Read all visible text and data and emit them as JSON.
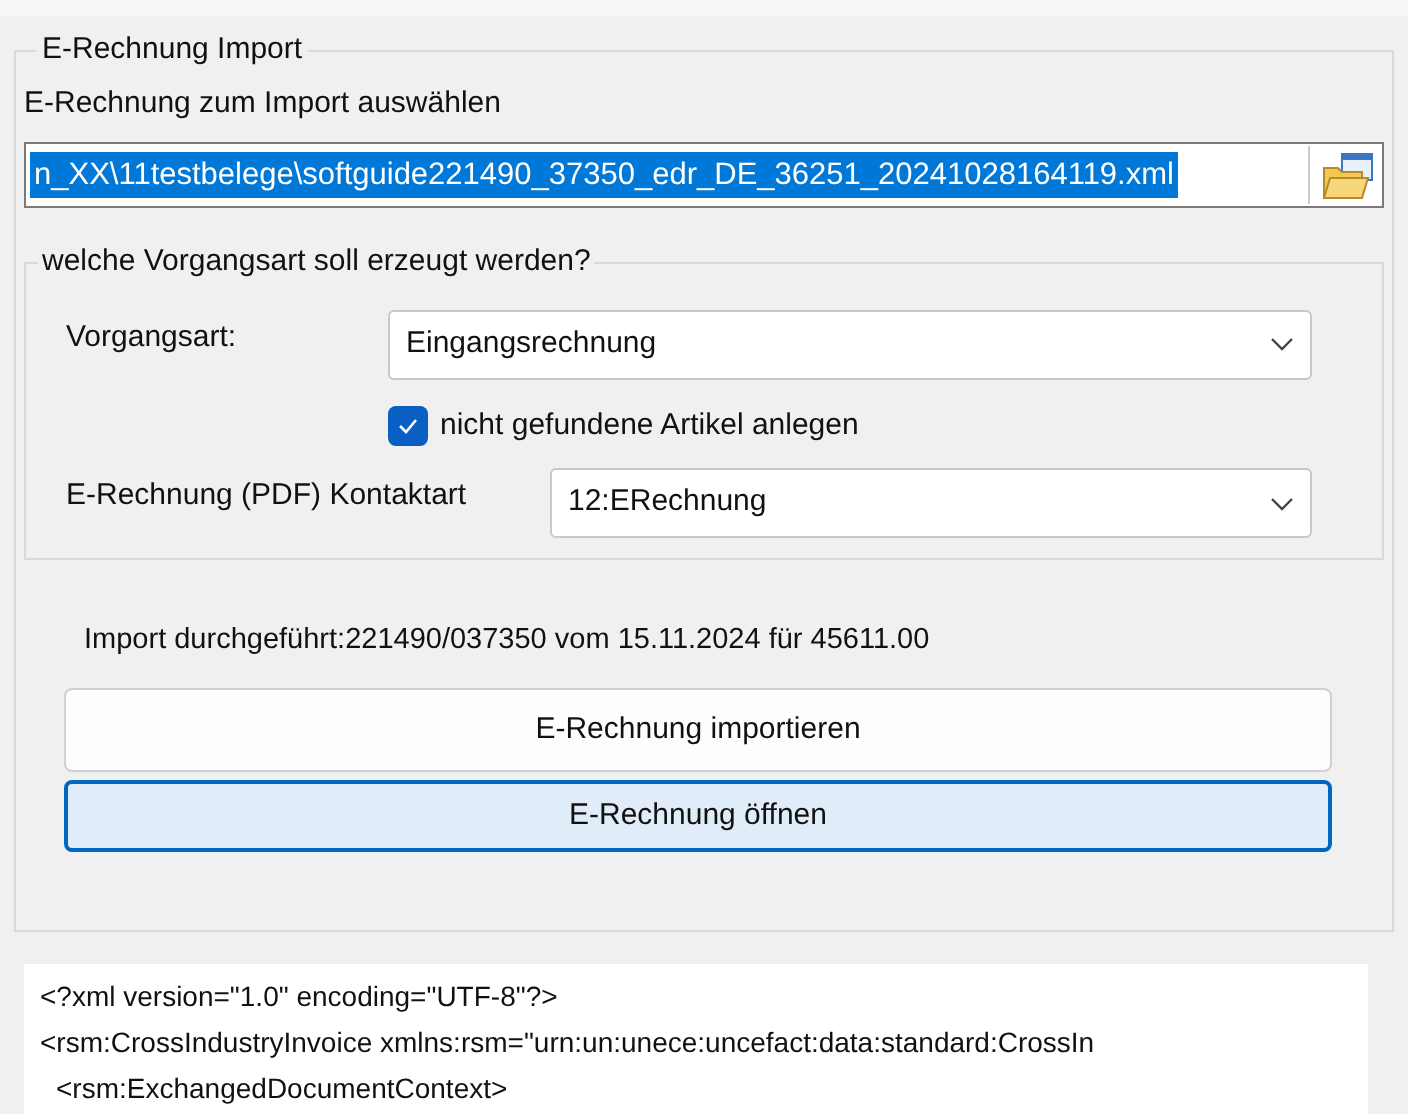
{
  "group": {
    "title": "E-Rechnung Import"
  },
  "file_label": "E-Rechnung zum Import auswählen",
  "file_path": {
    "value": "n_XX\\11testbelege\\softguide221490_37350_edr_DE_36251_20241028164119.xml",
    "selected": true
  },
  "subgroup": {
    "title": "welche Vorgangsart soll erzeugt werden?"
  },
  "vorgangsart": {
    "label": "Vorgangsart:",
    "value": "Eingangsrechnung"
  },
  "checkbox": {
    "label": "nicht gefundene Artikel anlegen",
    "checked": true
  },
  "kontaktart": {
    "label": "E-Rechnung (PDF) Kontaktart",
    "value": "12:ERechnung"
  },
  "status": "Import durchgeführt:221490/037350 vom 15.11.2024 für 45611.00",
  "buttons": [
    {
      "label": "E-Rechnung importieren",
      "focused": false
    },
    {
      "label": "E-Rechnung öffnen",
      "focused": true
    }
  ],
  "xml_lines": [
    {
      "text": "<?xml version=\"1.0\" encoding=\"UTF-8\"?>",
      "indent": false
    },
    {
      "text": "<rsm:CrossIndustryInvoice xmlns:rsm=\"urn:un:unece:uncefact:data:standard:CrossIn",
      "indent": false
    },
    {
      "text": "<rsm:ExchangedDocumentContext>",
      "indent": true
    }
  ]
}
